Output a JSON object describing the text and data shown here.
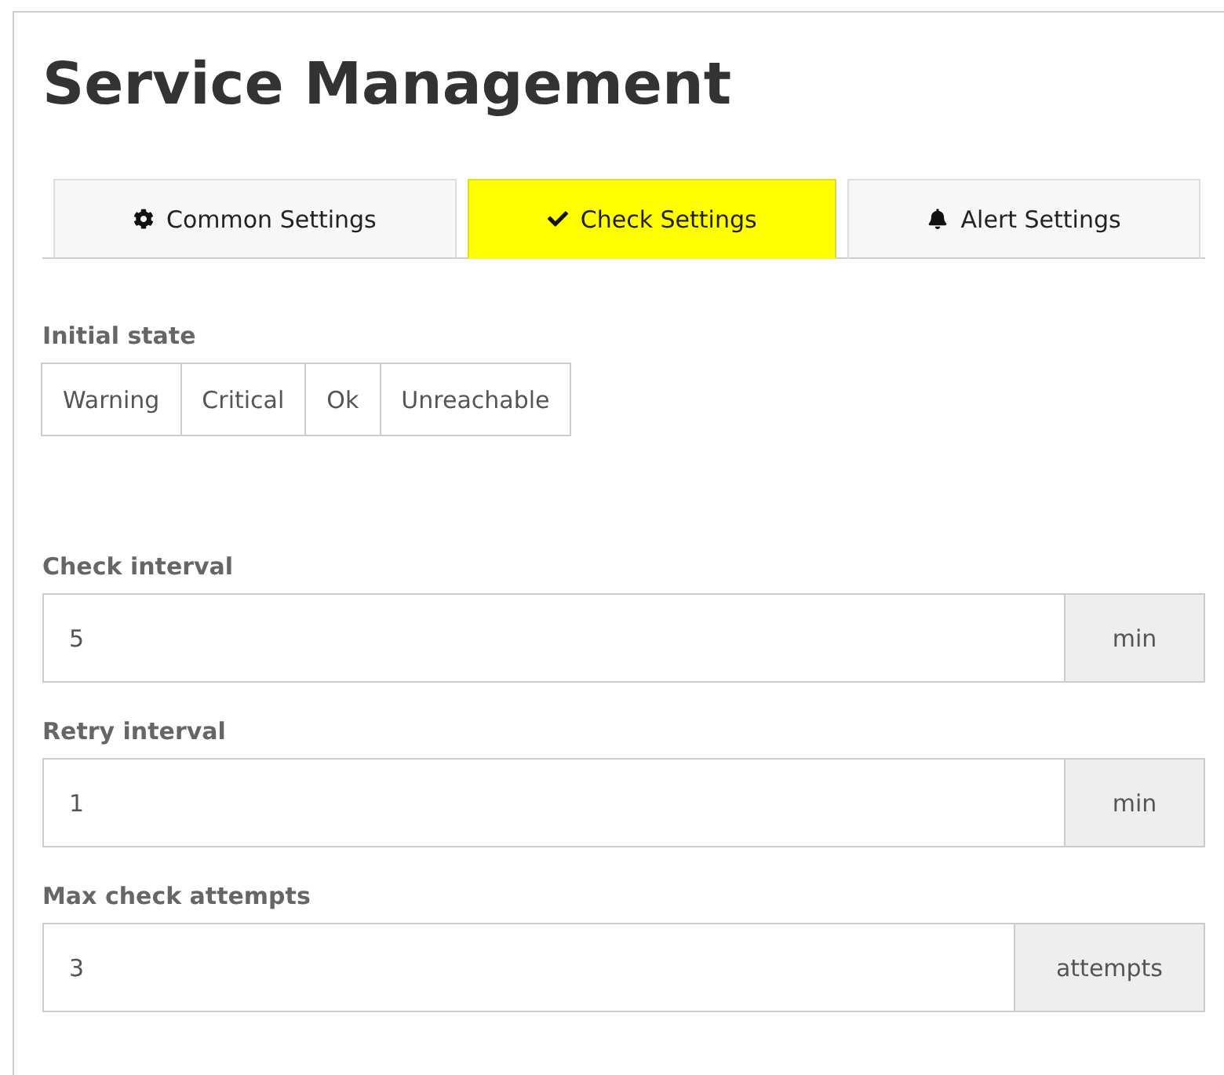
{
  "title": "Service Management",
  "tabs": [
    {
      "label": "Common Settings",
      "kind": "gear",
      "selected": false
    },
    {
      "label": "Check Settings",
      "kind": "check",
      "selected": true
    },
    {
      "label": "Alert Settings",
      "kind": "bell",
      "selected": false
    }
  ],
  "initial_state": {
    "label": "Initial state",
    "options": [
      {
        "label": "Warning",
        "selected": false
      },
      {
        "label": "Critical",
        "selected": false
      },
      {
        "label": "Ok",
        "selected": false
      },
      {
        "label": "Unreachable",
        "selected": false
      }
    ]
  },
  "fields": [
    {
      "label": "Check interval",
      "value": "5",
      "unit": "min"
    },
    {
      "label": "Retry interval",
      "value": "1",
      "unit": "min"
    },
    {
      "label": "Max check attempts",
      "value": "3",
      "unit": "attempts"
    }
  ]
}
